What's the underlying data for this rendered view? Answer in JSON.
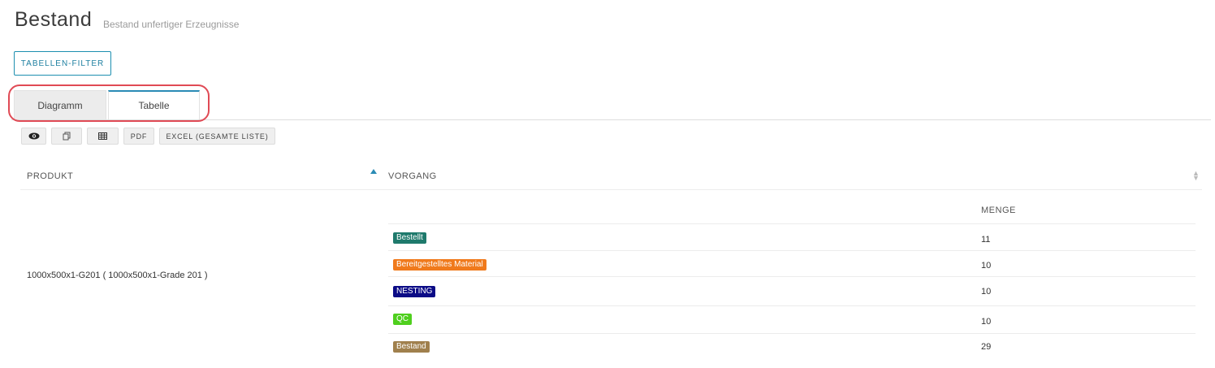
{
  "header": {
    "title": "Bestand",
    "subtitle": "Bestand unfertiger Erzeugnisse",
    "filter_button": "TABELLEN-FILTER"
  },
  "tabs": [
    {
      "label": "Diagramm",
      "active": false
    },
    {
      "label": "Tabelle",
      "active": true
    }
  ],
  "toolbar": {
    "visibility_icon": "eye-icon",
    "copy_icon": "copy-icon",
    "columns_icon": "grid-icon",
    "pdf_label": "PDF",
    "excel_label": "EXCEL (GESAMTE LISTE)"
  },
  "table": {
    "columns": {
      "produkt": "PRODUKT",
      "vorgang": "VORGANG",
      "menge": "MENGE"
    },
    "row": {
      "product": "1000x500x1-G201 ( 1000x500x1-Grade 201 )",
      "steps": [
        {
          "label": "Bestellt",
          "color": "#1f7a6c",
          "qty": "11"
        },
        {
          "label": "Bereitgestelltes Material",
          "color": "#f07a1c",
          "qty": "10"
        },
        {
          "label": "NESTING",
          "color": "#0b0b86",
          "qty": "10"
        },
        {
          "label": "QC",
          "color": "#4fcf1e",
          "qty": "10"
        },
        {
          "label": "Bestand",
          "color": "#a0804d",
          "qty": "29"
        }
      ]
    }
  }
}
